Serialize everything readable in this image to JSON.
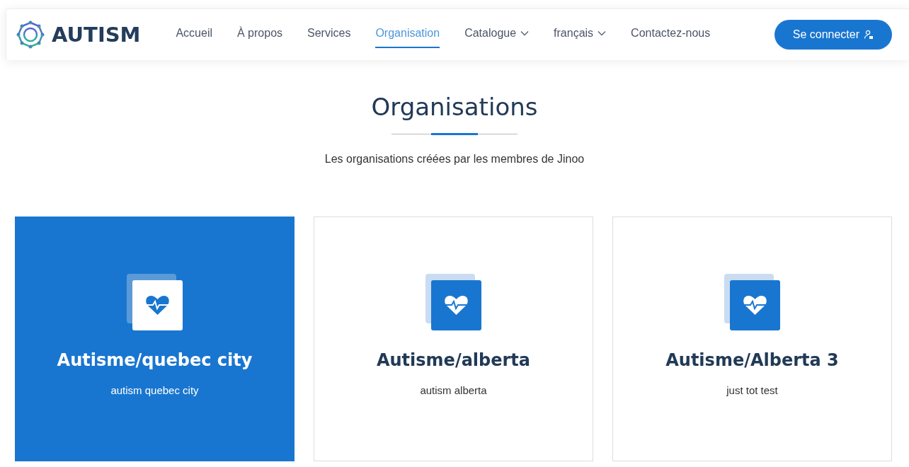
{
  "logo": {
    "text": "AUTISM"
  },
  "nav": [
    {
      "label": "Accueil",
      "kind": "link",
      "selected": false
    },
    {
      "label": "À propos",
      "kind": "link",
      "selected": false
    },
    {
      "label": "Services",
      "kind": "link",
      "selected": false
    },
    {
      "label": "Organisation",
      "kind": "link",
      "selected": true
    },
    {
      "label": "Catalogue",
      "kind": "dropdown",
      "selected": false
    },
    {
      "label": "français",
      "kind": "dropdown",
      "selected": false
    },
    {
      "label": "Contactez-nous",
      "kind": "link",
      "selected": false
    }
  ],
  "login_button": {
    "label": "Se connecter"
  },
  "section": {
    "title": "Organisations",
    "subtitle": "Les organisations créées par les membres de Jinoo"
  },
  "organisations": [
    {
      "name": "Autisme/quebec city",
      "description": "autism quebec city",
      "selected": true
    },
    {
      "name": "Autisme/alberta",
      "description": "autism alberta",
      "selected": false
    },
    {
      "name": "Autisme/Alberta 3",
      "description": "just tot test",
      "selected": false
    }
  ]
}
